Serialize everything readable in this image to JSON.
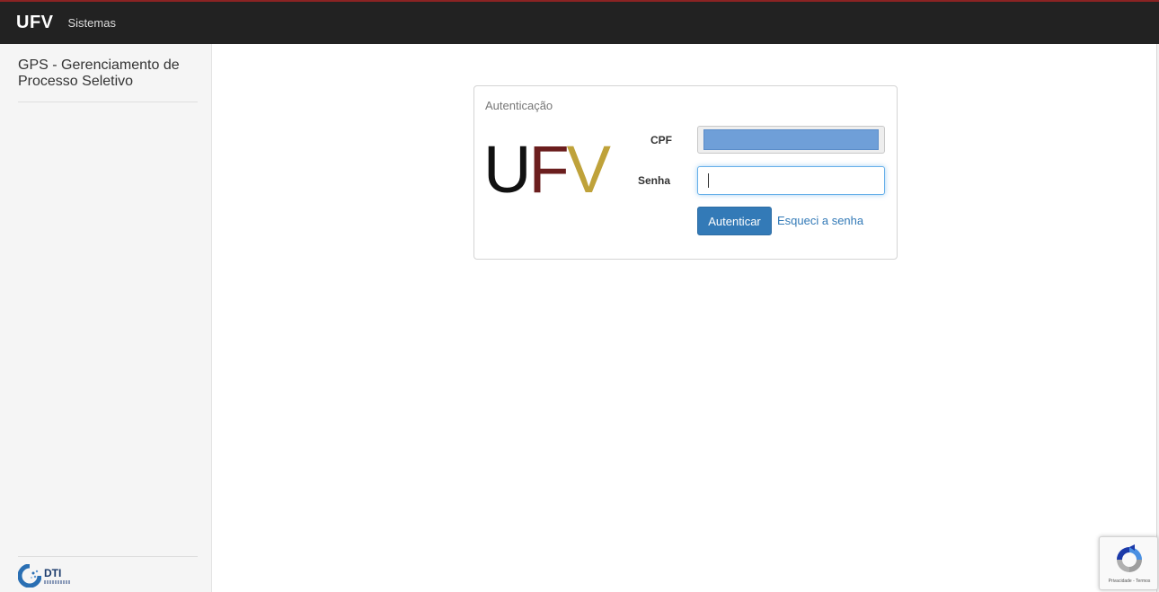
{
  "topbar": {
    "brand": "UFV",
    "nav_link": "Sistemas"
  },
  "sidebar": {
    "title": "GPS - Gerenciamento de Processo Seletivo",
    "footer_logo_label": "DTI"
  },
  "login_panel": {
    "title": "Autenticação",
    "logo": {
      "u": "U",
      "f": "F",
      "v": "V"
    },
    "cpf_label": "CPF",
    "senha_label": "Senha",
    "cpf_value": "",
    "senha_value": "",
    "submit_label": "Autenticar",
    "forgot_link": "Esqueci a senha"
  },
  "recaptcha": {
    "footer_text": "Privacidade - Termos"
  },
  "colors": {
    "topbar": "#222222",
    "accent": "#337ab7",
    "logo_u": "#111111",
    "logo_f": "#6b1e1e",
    "logo_v": "#bfa23a"
  }
}
